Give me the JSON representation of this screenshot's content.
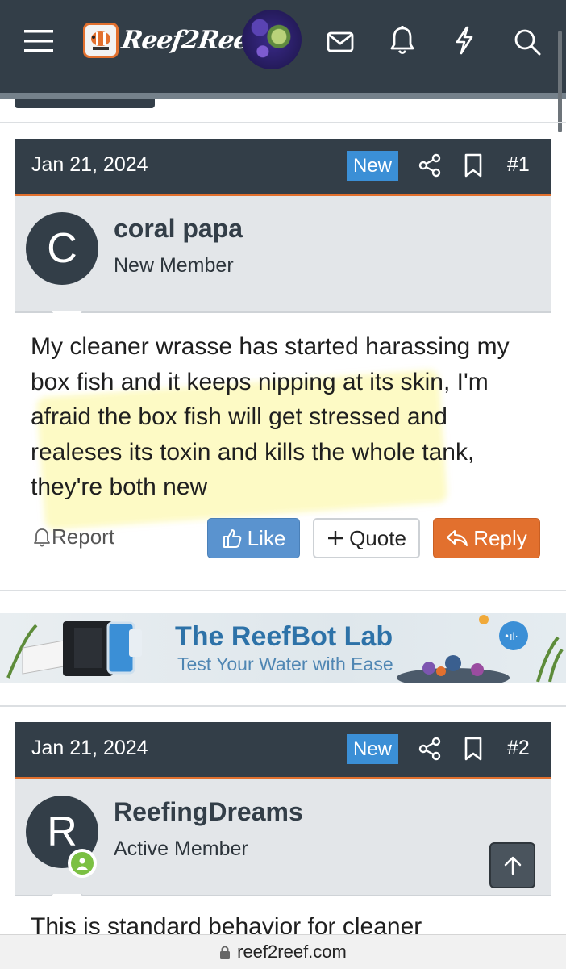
{
  "header": {
    "brand": "Reef2Reef",
    "icons": [
      "menu-icon",
      "mail-icon",
      "bell-icon",
      "lightning-icon",
      "search-icon"
    ]
  },
  "posts": [
    {
      "date": "Jan 21, 2024",
      "badge": "New",
      "number": "#1",
      "avatar_letter": "C",
      "username": "coral papa",
      "user_title": "New Member",
      "message": "My cleaner wrasse has started harassing my box fish and it keeps nipping at its skin, I'm afraid the box fish will get stressed and realeses its toxin and kills the whole tank, they're both new",
      "actions": {
        "report": "Report",
        "like": "Like",
        "quote": "Quote",
        "reply": "Reply"
      }
    },
    {
      "date": "Jan 21, 2024",
      "badge": "New",
      "number": "#2",
      "avatar_letter": "R",
      "username": "ReefingDreams",
      "user_title": "Active Member",
      "message_partial": "This is standard behavior for cleaner"
    }
  ],
  "ad": {
    "title": "The ReefBot Lab",
    "subtitle": "Test Your Water with Ease"
  },
  "url_bar": {
    "domain": "reef2reef.com"
  },
  "colors": {
    "header": "#333e48",
    "accent": "#e2702e",
    "badge": "#3b8fd6",
    "like": "#5a93cf"
  }
}
